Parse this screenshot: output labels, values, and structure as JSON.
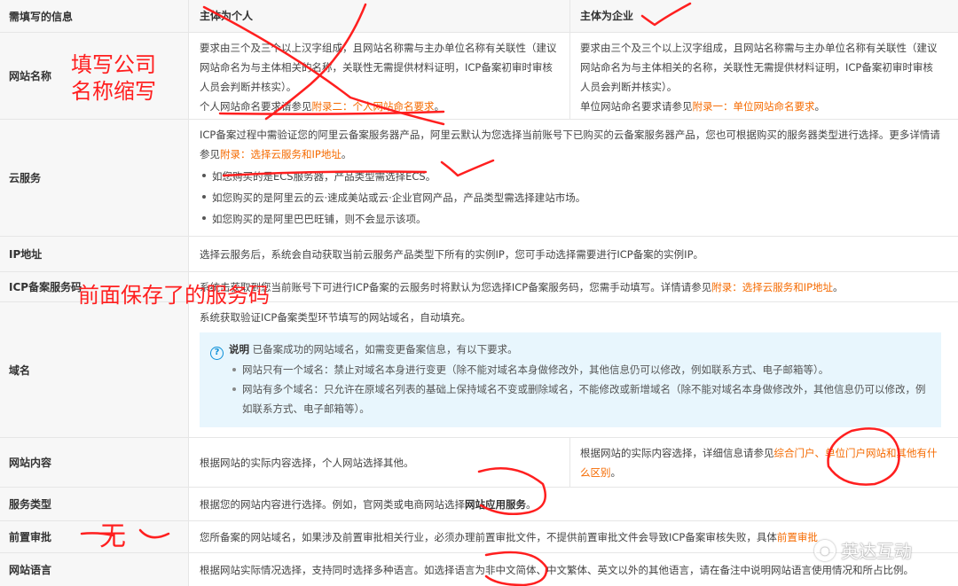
{
  "header": {
    "col1": "需填写的信息",
    "col2": "主体为个人",
    "col3": "主体为企业"
  },
  "rows": {
    "name": {
      "label": "网站名称",
      "personal_text": "要求由三个及三个以上汉字组成，且网站名称需与主办单位名称有关联性（建议网站命名为与主体相关的名称，关联性无需提供材料证明，ICP备案初审时审核人员会判断并核实）。",
      "personal_ref_prefix": "个人网站命名要求请参见",
      "personal_ref_link": "附录二：个人网站命名要求",
      "personal_ref_suffix": "。",
      "company_text": "要求由三个及三个以上汉字组成，且网站名称需与主办单位名称有关联性（建议网站命名为与主体相关的名称，关联性无需提供材料证明，ICP备案初审时审核人员会判断并核实）。",
      "company_ref_prefix": "单位网站命名要求请参见",
      "company_ref_link": "附录一：单位网站命名要求",
      "company_ref_suffix": "。"
    },
    "cloud": {
      "label": "云服务",
      "text": "ICP备案过程中需验证您的阿里云备案服务器产品，阿里云默认为您选择当前账号下已购买的云备案服务器产品，您也可根据购买的服务器类型进行选择。更多详情请参见",
      "link": "附录：选择云服务和IP地址",
      "suffix": "。",
      "bullets": [
        "如您购买的是ECS服务器，产品类型需选择ECS。",
        "如您购买的是阿里云的云·速成美站或云·企业官网产品，产品类型需选择建站市场。",
        "如您购买的是阿里巴巴旺铺，则不会显示该项。"
      ]
    },
    "ip": {
      "label": "IP地址",
      "text": "选择云服务后，系统会自动获取当前云服务产品类型下所有的实例IP，您可手动选择需要进行ICP备案的实例IP。"
    },
    "code": {
      "label": "ICP备案服务码",
      "text": "系统击获取到您当前账号下可进行ICP备案的云服务时将默认为您选择ICP备案服务码，您需手动填写。详情请参见",
      "link": "附录：选择云服务和IP地址",
      "suffix": "。"
    },
    "domain": {
      "label": "域名",
      "text": "系统获取验证ICP备案类型环节填写的网站域名，自动填充。",
      "note_title": "说明",
      "note_text": "已备案成功的网站域名，如需变更备案信息，有以下要求。",
      "note_bullets": [
        "网站只有一个域名：禁止对域名本身进行变更（除不能对域名本身做修改外，其他信息仍可以修改，例如联系方式、电子邮箱等）。",
        "网站有多个域名：只允许在原域名列表的基础上保持域名不变或删除域名，不能修改或新增域名（除不能对域名本身做修改外，其他信息仍可以修改，例如联系方式、电子邮箱等）。"
      ]
    },
    "content": {
      "label": "网站内容",
      "personal_text": "根据网站的实际内容选择，个人网站选择其他。",
      "company_text": "根据网站的实际内容选择，详细信息请参见",
      "company_link": "综合门户、单位门户网站和其他有什么区别",
      "company_suffix": "。"
    },
    "service": {
      "label": "服务类型",
      "text_prefix": "根据您的网站内容进行选择。例如，官网类或电商网站选择",
      "text_bold": "网站应用服务",
      "text_suffix": "。"
    },
    "preapproval": {
      "label": "前置审批",
      "text": "您所备案的网站域名，如果涉及前置审批相关行业，必须办理前置审批文件，不提供前置审批文件会导致ICP备案审核失败，具体",
      "link": "前置审批"
    },
    "language": {
      "label": "网站语言",
      "text": "根据网站实际情况选择，支持同时选择多种语言。如选择语言为非中文简体、中文繁体、英文以外的其他语言，请在备注中说明网站语言使用情况和所占比例。"
    }
  },
  "annotations": {
    "name_note_line1": "填写公司",
    "name_note_line2": "名称缩写",
    "code_note": "前面保存了的服务码",
    "preapproval_note": "无"
  },
  "watermark": {
    "text": "英达互动"
  },
  "colors": {
    "link": "#f56a00",
    "ink": "#ff1f1f",
    "note_bg": "#e8f6fd",
    "label_bg": "#f7f7f7"
  }
}
